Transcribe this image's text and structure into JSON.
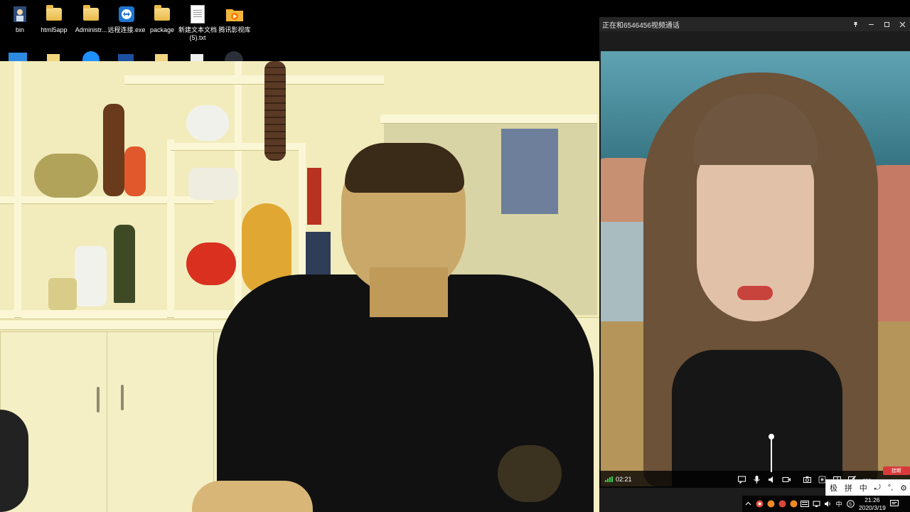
{
  "desktop": {
    "icons": [
      {
        "label": "bin",
        "icon": "user-profile-icon"
      },
      {
        "label": "html5app",
        "icon": "folder-icon"
      },
      {
        "label": "Administr...",
        "icon": "folder-user-icon"
      },
      {
        "label": "远程连接.exe",
        "icon": "teamviewer-icon"
      },
      {
        "label": "package",
        "icon": "folder-icon"
      },
      {
        "label": "新建文本文档\n(5).txt",
        "icon": "text-file-icon"
      },
      {
        "label": "腾讯影视库",
        "icon": "video-library-folder-icon"
      }
    ]
  },
  "call": {
    "window_title": "正在和6546456视频通话",
    "timer": "02:21",
    "hangup_label": "挂断",
    "volume_level": 1.0,
    "controls": [
      "chat-icon",
      "microphone-icon",
      "speaker-icon",
      "camera-toggle-icon",
      "screenshot-icon",
      "record-icon",
      "layout-icon",
      "edit-icon",
      "more-icon"
    ]
  },
  "ime": {
    "items": [
      "极",
      "拼",
      "中",
      "⤾",
      "°,",
      "⚙"
    ]
  },
  "taskbar": {
    "time": "21:26",
    "date": "2020/3/19",
    "ime_indicator": "中",
    "tray_icons": [
      "chevron-up-icon",
      "app-icon",
      "app-icon",
      "app-icon",
      "app-icon",
      "keyboard-icon",
      "network-icon",
      "volume-icon",
      "input-icon",
      "notification-icon"
    ]
  },
  "colors": {
    "signal": "#39d353",
    "hangup": "#d83a3a",
    "title_bar": "#262626"
  }
}
